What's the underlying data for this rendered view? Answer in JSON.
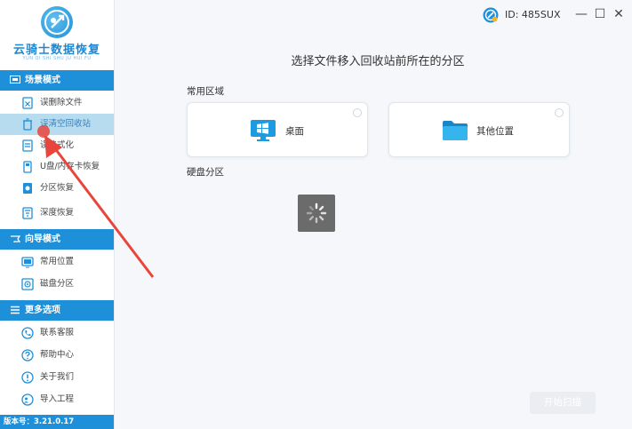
{
  "app": {
    "logo_title": "云骑士数据恢复",
    "logo_subtitle": "YUN QI SHI SHU JU HUI FU",
    "version_label": "版本号：3.21.0.17"
  },
  "sidebar": {
    "sections": [
      {
        "title": "场景模式",
        "icon": "scene-icon",
        "items": [
          {
            "label": "误删除文件",
            "icon": "deleted-file-icon"
          },
          {
            "label": "误清空回收站",
            "icon": "recycle-bin-icon"
          },
          {
            "label": "误格式化",
            "icon": "format-icon"
          },
          {
            "label": "U盘/内存卡恢复",
            "icon": "usb-card-icon"
          },
          {
            "label": "分区恢复",
            "icon": "partition-icon"
          },
          {
            "label": "深度恢复",
            "icon": "deep-scan-icon"
          }
        ]
      },
      {
        "title": "向导模式",
        "icon": "guide-icon",
        "items": [
          {
            "label": "常用位置",
            "icon": "common-location-icon"
          },
          {
            "label": "磁盘分区",
            "icon": "disk-partition-icon"
          }
        ]
      },
      {
        "title": "更多选项",
        "icon": "menu-icon",
        "items": [
          {
            "label": "联系客服",
            "icon": "phone-icon"
          },
          {
            "label": "帮助中心",
            "icon": "help-icon"
          },
          {
            "label": "关于我们",
            "icon": "info-icon"
          },
          {
            "label": "导入工程",
            "icon": "import-icon"
          }
        ]
      }
    ],
    "active_item": "误清空回收站"
  },
  "header": {
    "user_id": "ID: 485SUX",
    "minimize": "—",
    "maximize": "☐",
    "close": "✕"
  },
  "main": {
    "title": "选择文件移入回收站前所在的分区",
    "common_area_label": "常用区域",
    "cards": [
      {
        "label": "桌面",
        "icon": "desktop-icon"
      },
      {
        "label": "其他位置",
        "icon": "folder-icon"
      }
    ],
    "disk_partition_label": "硬盘分区",
    "loading": "loading-spinner",
    "scan_button": "开始扫描"
  },
  "colors": {
    "accent": "#1e8fd9",
    "active_item_bg": "#b7dcf0",
    "annotation_arrow": "#e8453c"
  }
}
